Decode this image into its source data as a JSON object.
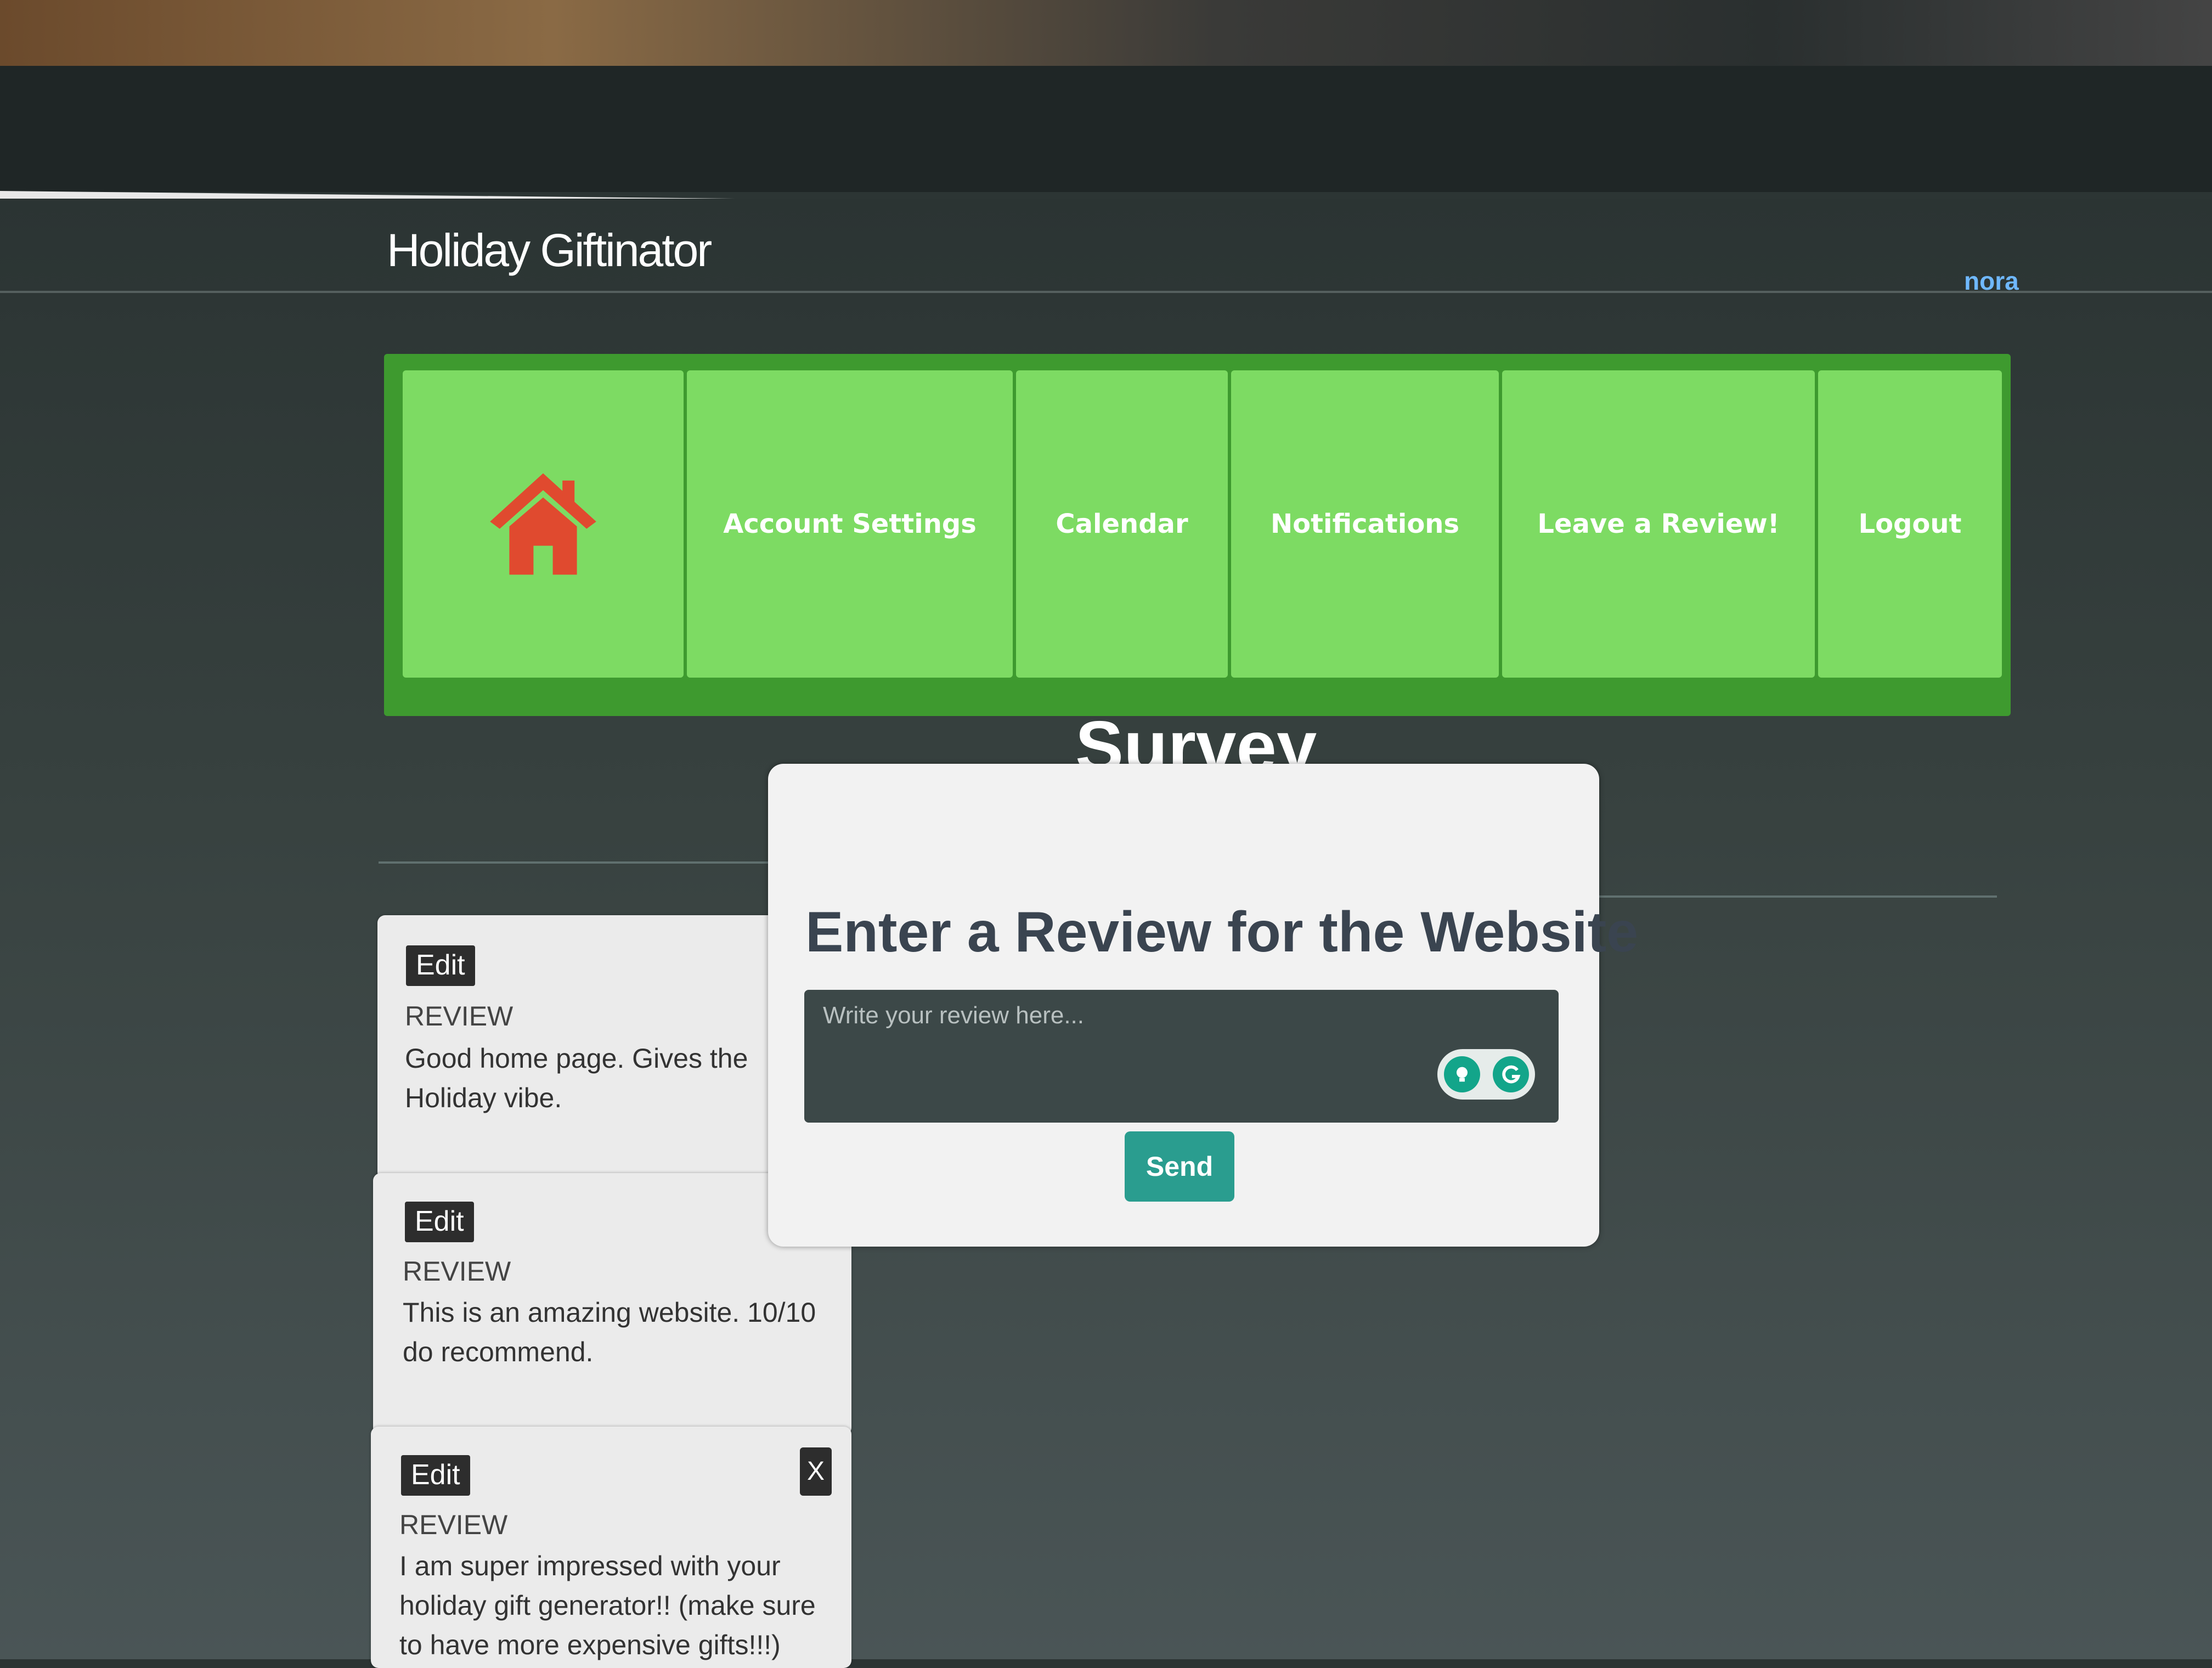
{
  "app": {
    "title": "Holiday Giftinator",
    "user": "nora"
  },
  "menu": {
    "home_icon": "home-icon",
    "items": [
      {
        "label": "Account Settings"
      },
      {
        "label": "Calendar"
      },
      {
        "label": "Notifications"
      },
      {
        "label": "Leave a Review!"
      },
      {
        "label": "Logout"
      }
    ]
  },
  "page": {
    "title": "Survey"
  },
  "modal": {
    "title": "Enter a Review for the Website",
    "placeholder": "Write your review here...",
    "send_label": "Send",
    "extension_icons": [
      "lightbulb-icon",
      "grammarly-icon"
    ]
  },
  "reviews": [
    {
      "edit_label": "Edit",
      "tag": "REVIEW",
      "text": "Good home page. Gives the Holiday vibe."
    },
    {
      "edit_label": "Edit",
      "tag": "REVIEW",
      "text": "This is an amazing website. 10/10 do recommend."
    },
    {
      "edit_label": "Edit",
      "close_label": "X",
      "tag": "REVIEW",
      "text": "I am super impressed with your holiday gift generator!! (make sure to have more expensive gifts!!!)"
    }
  ],
  "colors": {
    "menu_bg": "#3e9a2f",
    "tile_bg": "#7ddb63",
    "home_icon": "#e04a2f",
    "send_button": "#2a9d8f",
    "user_link": "#6fb8ff"
  }
}
